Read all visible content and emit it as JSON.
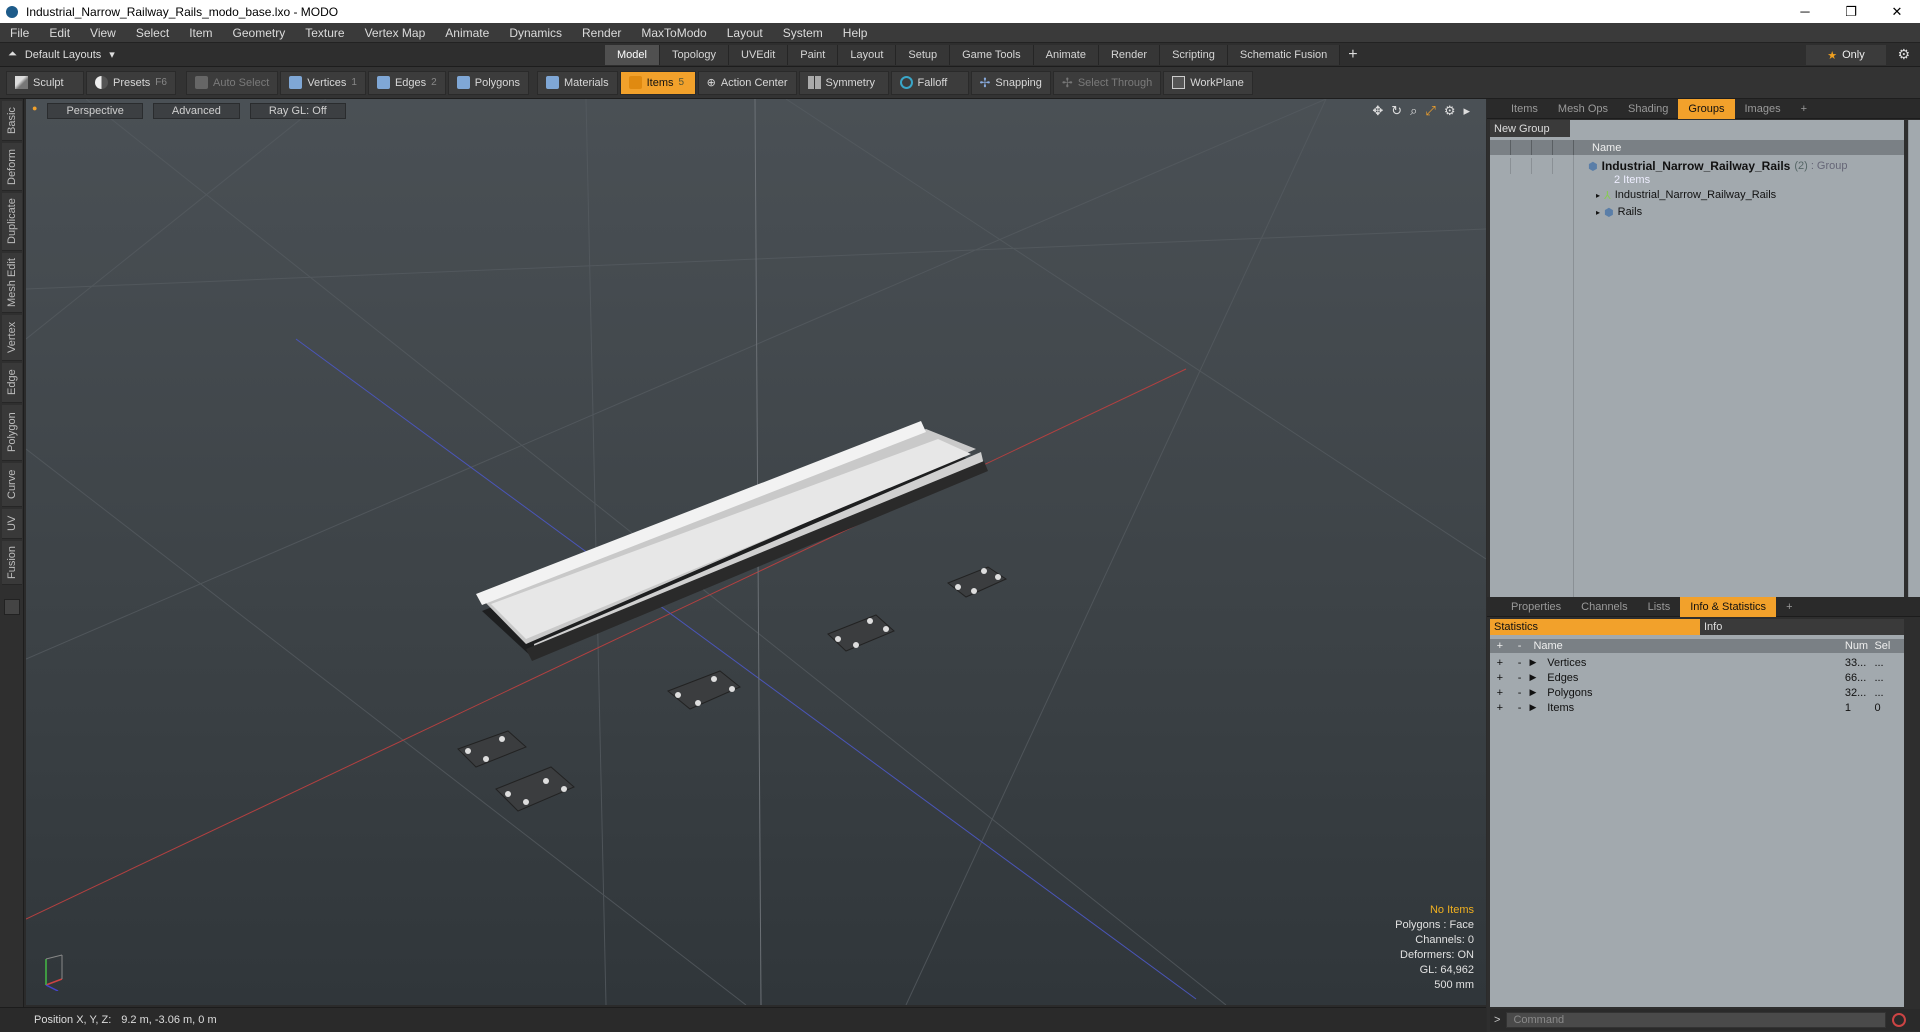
{
  "window": {
    "title": "Industrial_Narrow_Railway_Rails_modo_base.lxo - MODO"
  },
  "menu": [
    "File",
    "Edit",
    "View",
    "Select",
    "Item",
    "Geometry",
    "Texture",
    "Vertex Map",
    "Animate",
    "Dynamics",
    "Render",
    "MaxToModo",
    "Layout",
    "System",
    "Help"
  ],
  "layouts": {
    "label": "Default Layouts"
  },
  "main_tabs": [
    "Model",
    "Topology",
    "UVEdit",
    "Paint",
    "Layout",
    "Setup",
    "Game Tools",
    "Animate",
    "Render",
    "Scripting",
    "Schematic Fusion"
  ],
  "active_main_tab": "Model",
  "only_label": "Only",
  "toolbar": {
    "sculpt": "Sculpt",
    "presets": "Presets",
    "presets_key": "F6",
    "auto_select": "Auto Select",
    "vertices": "Vertices",
    "vertices_key": "1",
    "edges": "Edges",
    "edges_key": "2",
    "polygons": "Polygons",
    "materials": "Materials",
    "items": "Items",
    "items_key": "5",
    "action_center": "Action Center",
    "symmetry": "Symmetry",
    "falloff": "Falloff",
    "snapping": "Snapping",
    "select_through": "Select Through",
    "workplane": "WorkPlane"
  },
  "left_tabs": [
    "Basic",
    "Deform",
    "Duplicate",
    "Mesh Edit",
    "Vertex",
    "Edge",
    "Polygon",
    "Curve",
    "UV",
    "Fusion"
  ],
  "viewport": {
    "view": "Perspective",
    "mode": "Advanced",
    "raygl": "Ray GL: Off",
    "hud": {
      "no_items": "No Items",
      "polygons": "Polygons : Face",
      "channels": "Channels: 0",
      "deformers": "Deformers: ON",
      "gl": "GL: 64,962",
      "scale": "500 mm"
    }
  },
  "status": {
    "label": "Position X, Y, Z:",
    "value": "9.2 m, -3.06 m, 0 m"
  },
  "top_panel_tabs": [
    "Items",
    "Mesh Ops",
    "Shading",
    "Groups",
    "Images"
  ],
  "active_top_tab": "Groups",
  "groups": {
    "new_group": "New Group",
    "name_header": "Name",
    "group_name": "Industrial_Narrow_Railway_Rails",
    "group_count": "(2)",
    "group_type": ": Group",
    "group_items": "2 Items",
    "children": [
      "Industrial_Narrow_Railway_Rails",
      "Rails"
    ]
  },
  "bottom_panel_tabs": [
    "Properties",
    "Channels",
    "Lists",
    "Info & Statistics"
  ],
  "active_bottom_tab": "Info & Statistics",
  "stats": {
    "tab_statistics": "Statistics",
    "tab_info": "Info",
    "col_name": "Name",
    "col_num": "Num",
    "col_sel": "Sel",
    "rows": [
      {
        "name": "Vertices",
        "num": "33...",
        "sel": "..."
      },
      {
        "name": "Edges",
        "num": "66...",
        "sel": "..."
      },
      {
        "name": "Polygons",
        "num": "32...",
        "sel": "..."
      },
      {
        "name": "Items",
        "num": "1",
        "sel": "0"
      }
    ]
  },
  "command": {
    "placeholder": "Command"
  }
}
